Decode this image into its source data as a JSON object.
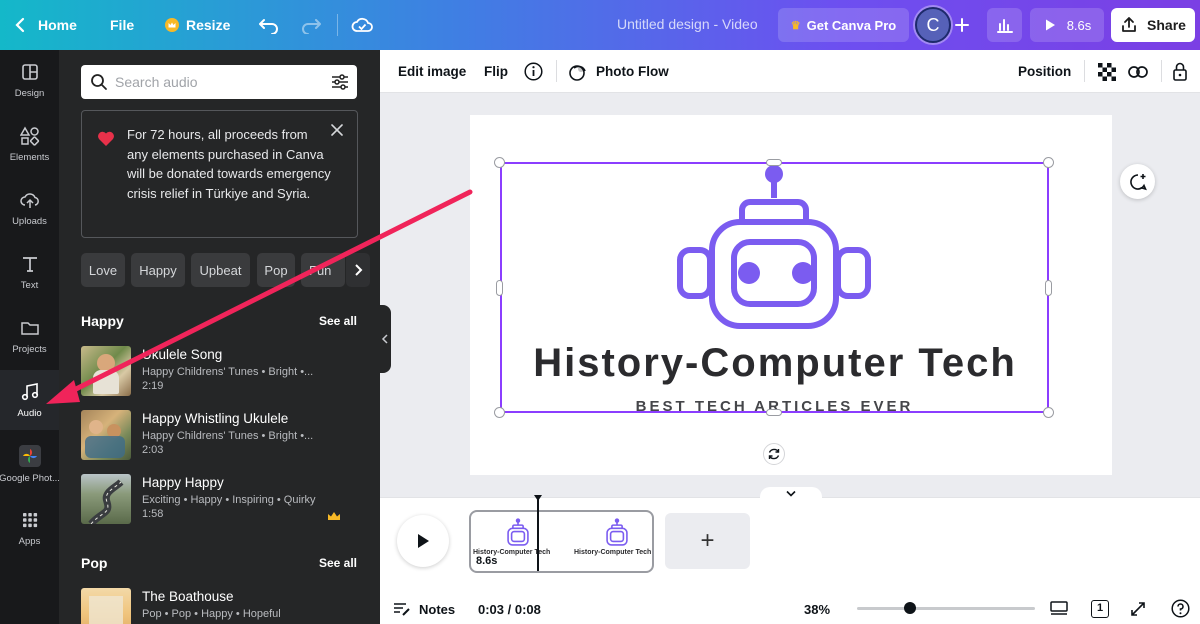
{
  "topbar": {
    "home_label": "Home",
    "file_label": "File",
    "resize_label": "Resize",
    "doc_title": "Untitled design - Video",
    "get_pro_label": "Get Canva Pro",
    "avatar_letter": "C",
    "play_duration": "8.6s",
    "share_label": "Share"
  },
  "rail": {
    "items": [
      {
        "label": "Design",
        "icon": "layout-icon"
      },
      {
        "label": "Elements",
        "icon": "shapes-icon"
      },
      {
        "label": "Uploads",
        "icon": "cloud-upload-icon"
      },
      {
        "label": "Text",
        "icon": "text-icon"
      },
      {
        "label": "Projects",
        "icon": "folder-icon"
      },
      {
        "label": "Audio",
        "icon": "music-note-icon"
      },
      {
        "label": "Google Phot...",
        "icon": "google-photos-icon"
      },
      {
        "label": "Apps",
        "icon": "apps-grid-icon"
      }
    ],
    "active": "Audio"
  },
  "panel": {
    "search_placeholder": "Search audio",
    "notice_text": "For 72 hours, all proceeds from any elements purchased in Canva will be donated towards emergency crisis relief in Türkiye and Syria.",
    "chips": [
      "Love",
      "Happy",
      "Upbeat",
      "Pop",
      "Fun"
    ],
    "sections": [
      {
        "title": "Happy",
        "see_all": "See all",
        "tracks": [
          {
            "title": "Ukulele Song",
            "subtitle": "Happy Childrens' Tunes • Bright •...",
            "duration": "2:19",
            "pro": false
          },
          {
            "title": "Happy Whistling Ukulele",
            "subtitle": "Happy Childrens' Tunes • Bright •...",
            "duration": "2:03",
            "pro": false
          },
          {
            "title": "Happy Happy",
            "subtitle": "Exciting • Happy • Inspiring • Quirky",
            "duration": "1:58",
            "pro": true
          }
        ]
      },
      {
        "title": "Pop",
        "see_all": "See all",
        "tracks": [
          {
            "title": "The Boathouse",
            "subtitle": "Pop • Pop • Happy • Hopeful",
            "duration": "",
            "pro": true
          }
        ]
      }
    ]
  },
  "context_toolbar": {
    "edit_image": "Edit image",
    "flip": "Flip",
    "photo_flow": "Photo Flow",
    "position": "Position"
  },
  "canvas": {
    "logo_title": "History-Computer Tech",
    "logo_subtitle": "BEST TECH ARTICLES EVER"
  },
  "timeline": {
    "clip_duration": "8.6s",
    "clip_text": "History-Computer Tech",
    "add_page": "+",
    "notes_label": "Notes",
    "time_readout": "0:03 / 0:08",
    "zoom": "38%",
    "page_count": "1",
    "zoom_level": 0.3
  },
  "colors": {
    "accent": "#8b3dff",
    "arrow": "#f0245a",
    "robot": "#7b5cf0"
  }
}
